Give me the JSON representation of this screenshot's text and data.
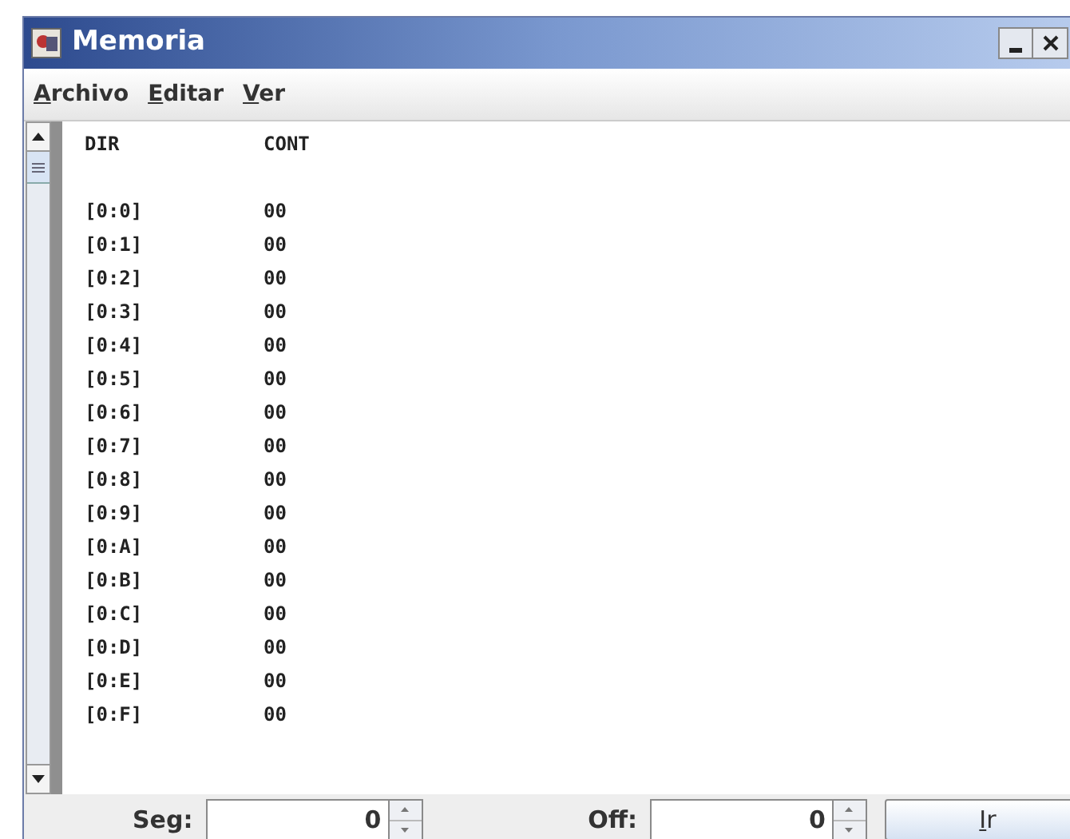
{
  "window": {
    "title": "Memoria"
  },
  "menu": [
    {
      "label": "Archivo",
      "mnemonic_underlined": true
    },
    {
      "label": "Editar",
      "mnemonic_underlined": true
    },
    {
      "label": "Ver",
      "mnemonic_underlined": true
    }
  ],
  "table": {
    "columns": [
      "DIR",
      "CONT"
    ],
    "rows": [
      [
        "[0:0]",
        "00"
      ],
      [
        "[0:1]",
        "00"
      ],
      [
        "[0:2]",
        "00"
      ],
      [
        "[0:3]",
        "00"
      ],
      [
        "[0:4]",
        "00"
      ],
      [
        "[0:5]",
        "00"
      ],
      [
        "[0:6]",
        "00"
      ],
      [
        "[0:7]",
        "00"
      ],
      [
        "[0:8]",
        "00"
      ],
      [
        "[0:9]",
        "00"
      ],
      [
        "[0:A]",
        "00"
      ],
      [
        "[0:B]",
        "00"
      ],
      [
        "[0:C]",
        "00"
      ],
      [
        "[0:D]",
        "00"
      ],
      [
        "[0:E]",
        "00"
      ],
      [
        "[0:F]",
        "00"
      ]
    ]
  },
  "footer": {
    "segment": {
      "label": "Seg:",
      "value": "0"
    },
    "offset": {
      "label": "Off:",
      "value": "0"
    },
    "button": {
      "label": "Ir",
      "mnemonic_underlined": true
    }
  }
}
